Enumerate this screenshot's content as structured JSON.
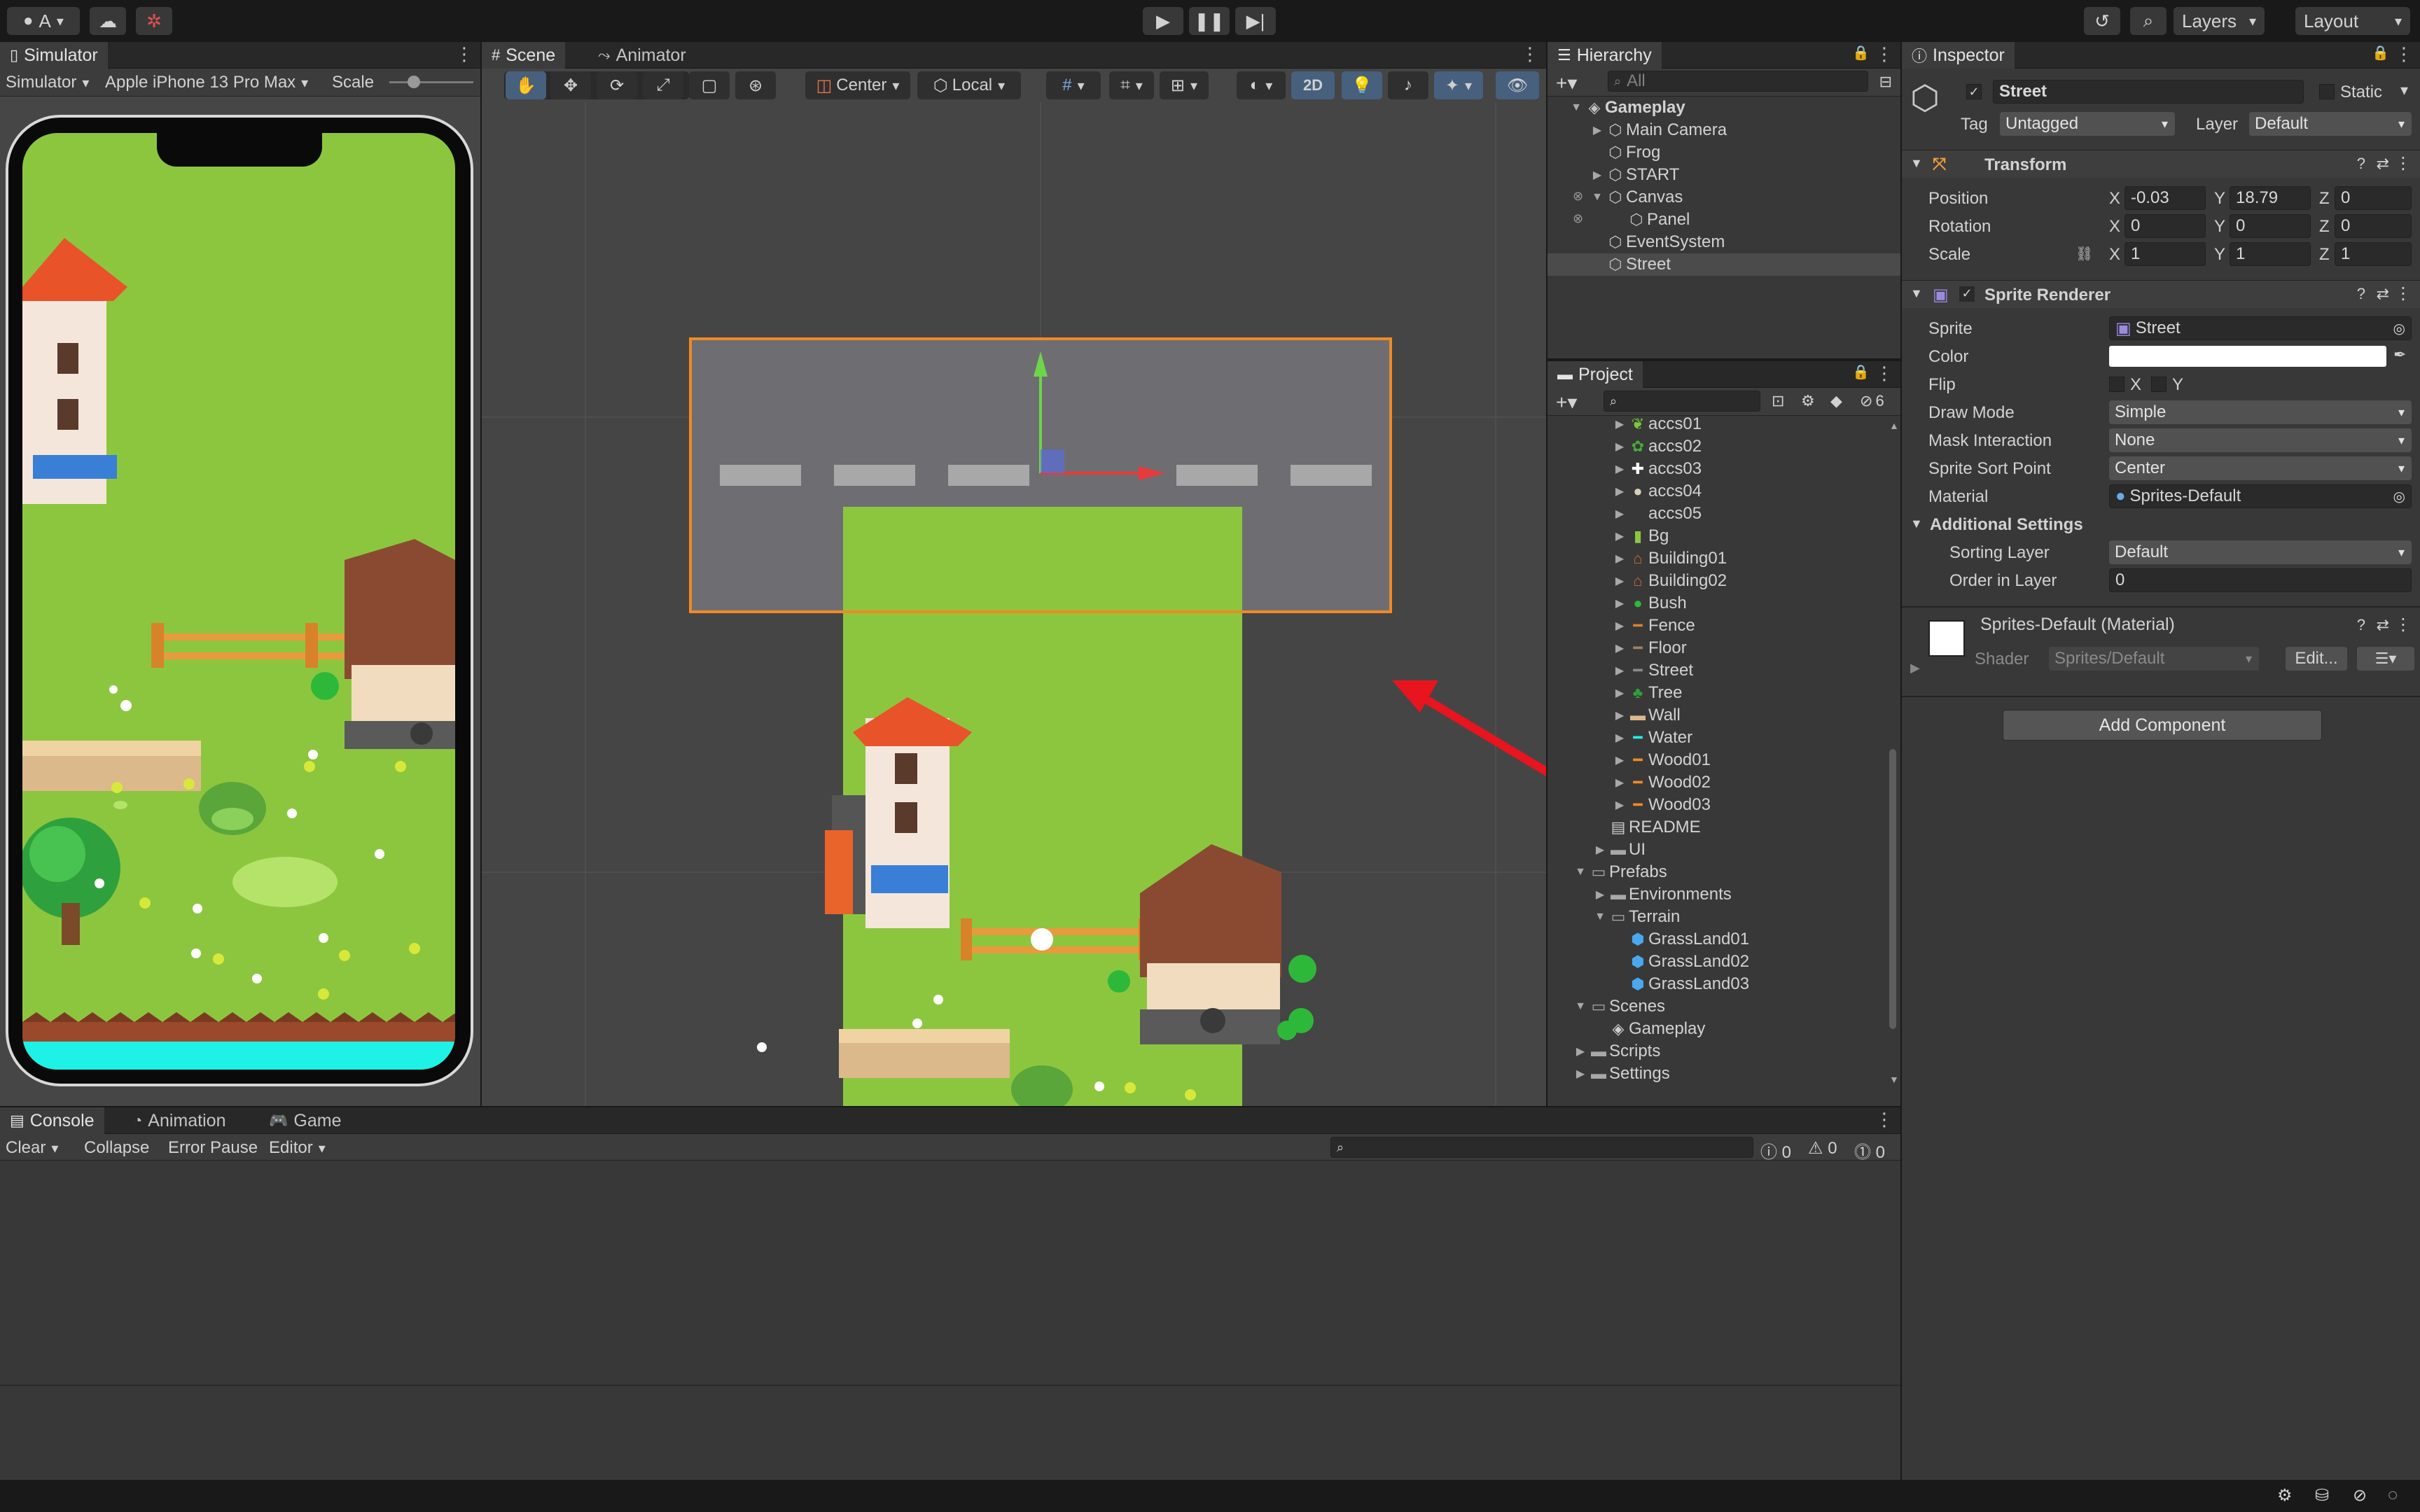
{
  "toolbar": {
    "account_label": "A",
    "layers_label": "Layers",
    "layout_label": "Layout"
  },
  "simulator": {
    "tab_label": "Simulator",
    "mode_label": "Simulator",
    "device_label": "Apple iPhone 13 Pro Max",
    "scale_label": "Scale"
  },
  "scene": {
    "tab_scene": "Scene",
    "tab_animator": "Animator",
    "pivot_label": "Center",
    "space_label": "Local",
    "mode_2d": "2D"
  },
  "hierarchy": {
    "tab_label": "Hierarchy",
    "search_placeholder": "All",
    "items": [
      {
        "label": "Gameplay",
        "depth": 0,
        "expanded": true,
        "type": "scene"
      },
      {
        "label": "Main Camera",
        "depth": 1,
        "expanded": false,
        "type": "object"
      },
      {
        "label": "Frog",
        "depth": 1,
        "expanded": false,
        "type": "object"
      },
      {
        "label": "START",
        "depth": 1,
        "expanded": false,
        "type": "object"
      },
      {
        "label": "Canvas",
        "depth": 1,
        "expanded": true,
        "type": "object"
      },
      {
        "label": "Panel",
        "depth": 2,
        "expanded": false,
        "type": "object"
      },
      {
        "label": "EventSystem",
        "depth": 1,
        "expanded": false,
        "type": "object"
      },
      {
        "label": "Street",
        "depth": 1,
        "expanded": false,
        "type": "object",
        "selected": true
      }
    ]
  },
  "project": {
    "tab_label": "Project",
    "hidden_count": "6",
    "items": [
      {
        "label": "accs01",
        "depth": 2,
        "icon": "leaf"
      },
      {
        "label": "accs02",
        "depth": 2,
        "icon": "plant"
      },
      {
        "label": "accs03",
        "depth": 2,
        "icon": "flower"
      },
      {
        "label": "accs04",
        "depth": 2,
        "icon": "rock"
      },
      {
        "label": "accs05",
        "depth": 2,
        "icon": "none"
      },
      {
        "label": "Bg",
        "depth": 2,
        "icon": "bg"
      },
      {
        "label": "Building01",
        "depth": 2,
        "icon": "house"
      },
      {
        "label": "Building02",
        "depth": 2,
        "icon": "house"
      },
      {
        "label": "Bush",
        "depth": 2,
        "icon": "bush"
      },
      {
        "label": "Fence",
        "depth": 2,
        "icon": "fence"
      },
      {
        "label": "Floor",
        "depth": 2,
        "icon": "floor"
      },
      {
        "label": "Street",
        "depth": 2,
        "icon": "street"
      },
      {
        "label": "Tree",
        "depth": 2,
        "icon": "tree"
      },
      {
        "label": "Wall",
        "depth": 2,
        "icon": "wall"
      },
      {
        "label": "Water",
        "depth": 2,
        "icon": "water"
      },
      {
        "label": "Wood01",
        "depth": 2,
        "icon": "wood"
      },
      {
        "label": "Wood02",
        "depth": 2,
        "icon": "wood"
      },
      {
        "label": "Wood03",
        "depth": 2,
        "icon": "wood"
      },
      {
        "label": "README",
        "depth": 1,
        "icon": "doc"
      },
      {
        "label": "UI",
        "depth": 1,
        "icon": "folder"
      },
      {
        "label": "Prefabs",
        "depth": 0,
        "icon": "folder-open"
      },
      {
        "label": "Environments",
        "depth": 1,
        "icon": "folder"
      },
      {
        "label": "Terrain",
        "depth": 1,
        "icon": "folder-open"
      },
      {
        "label": "GrassLand01",
        "depth": 2,
        "icon": "prefab"
      },
      {
        "label": "GrassLand02",
        "depth": 2,
        "icon": "prefab"
      },
      {
        "label": "GrassLand03",
        "depth": 2,
        "icon": "prefab"
      },
      {
        "label": "Scenes",
        "depth": 0,
        "icon": "folder-open"
      },
      {
        "label": "Gameplay",
        "depth": 1,
        "icon": "scene"
      },
      {
        "label": "Scripts",
        "depth": 0,
        "icon": "folder"
      },
      {
        "label": "Settings",
        "depth": 0,
        "icon": "folder"
      }
    ]
  },
  "inspector": {
    "tab_label": "Inspector",
    "object_name": "Street",
    "static_label": "Static",
    "tag_label": "Tag",
    "tag_value": "Untagged",
    "layer_label": "Layer",
    "layer_value": "Default",
    "transform": {
      "title": "Transform",
      "position_label": "Position",
      "pos_x": "-0.03",
      "pos_y": "18.79",
      "pos_z": "0",
      "rotation_label": "Rotation",
      "rot_x": "0",
      "rot_y": "0",
      "rot_z": "0",
      "scale_label": "Scale",
      "scale_x": "1",
      "scale_y": "1",
      "scale_z": "1"
    },
    "sprite_renderer": {
      "title": "Sprite Renderer",
      "sprite_label": "Sprite",
      "sprite_value": "Street",
      "color_label": "Color",
      "flip_label": "Flip",
      "flip_x": "X",
      "flip_y": "Y",
      "draw_mode_label": "Draw Mode",
      "draw_mode_value": "Simple",
      "mask_label": "Mask Interaction",
      "mask_value": "None",
      "sort_point_label": "Sprite Sort Point",
      "sort_point_value": "Center",
      "material_label": "Material",
      "material_value": "Sprites-Default",
      "additional_label": "Additional Settings",
      "sorting_layer_label": "Sorting Layer",
      "sorting_layer_value": "Default",
      "order_label": "Order in Layer",
      "order_value": "0"
    },
    "material": {
      "title": "Sprites-Default (Material)",
      "shader_label": "Shader",
      "shader_value": "Sprites/Default",
      "edit_label": "Edit..."
    },
    "add_component_label": "Add Component"
  },
  "console": {
    "tab_console": "Console",
    "tab_animation": "Animation",
    "tab_game": "Game",
    "clear_label": "Clear",
    "collapse_label": "Collapse",
    "error_pause_label": "Error Pause",
    "editor_label": "Editor",
    "info_count": "0",
    "warn_count": "0",
    "error_count": "0"
  },
  "colors": {
    "selection_orange": "#f08a24",
    "arrow_red": "#e8141e",
    "grass": "#8cc63f",
    "road": "#6e6e72",
    "water": "#1ef2e6"
  }
}
